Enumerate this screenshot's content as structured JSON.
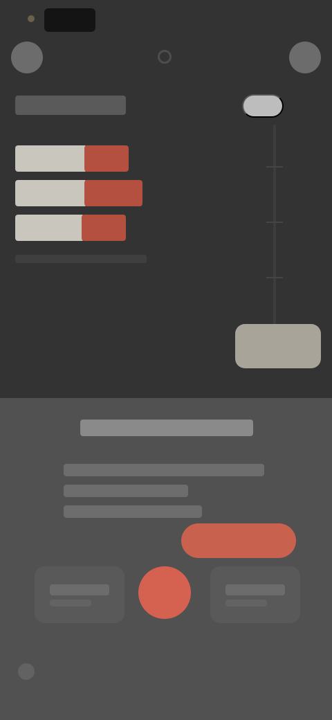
{
  "status_bar": {
    "time": ""
  },
  "header": {
    "left_button_icon": "menu-icon",
    "center_icon": "info-icon",
    "right_button_icon": "profile-icon"
  },
  "main": {
    "title": "",
    "chip_label": "",
    "levels": [
      {
        "label": "",
        "light_fraction": 0.52,
        "red_fraction": 0.32
      },
      {
        "label": "",
        "light_fraction": 0.52,
        "red_fraction": 0.42
      },
      {
        "label": "",
        "light_fraction": 0.5,
        "red_fraction": 0.32
      }
    ],
    "levels_caption": "",
    "primary_button": "",
    "slider_position": 0.1
  },
  "sheet": {
    "title": "",
    "lines": [
      "",
      "",
      ""
    ],
    "cta": "",
    "option_left": {
      "title": "",
      "subtitle": ""
    },
    "option_right": {
      "title": "",
      "subtitle": ""
    },
    "record_icon": "record-icon"
  },
  "colors": {
    "accent": "#d56251",
    "top_bg": "#333333",
    "sheet_bg": "#515151"
  }
}
